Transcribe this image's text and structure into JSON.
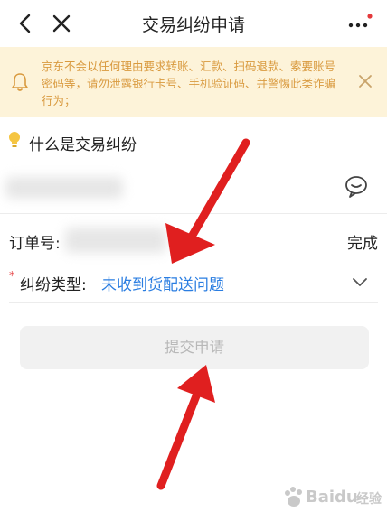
{
  "nav": {
    "title": "交易纠纷申请",
    "back_icon": "chevron-left-icon",
    "close_icon": "close-icon",
    "more_icon": "more-dots-icon"
  },
  "notice": {
    "text": "京东不会以任何理由要求转账、汇款、扫码退款、索要账号密码等，请勿泄露银行卡号、手机验证码、并警惕此类诈骗行为；"
  },
  "help": {
    "text": "什么是交易纠纷"
  },
  "form": {
    "order_label": "订单号:",
    "order_done": "完成",
    "type_label": "纠纷类型:",
    "type_value": "未收到货配送问题",
    "required_mark": "*"
  },
  "submit": {
    "label": "提交申请"
  },
  "watermark": {
    "brand": "Baidu",
    "suffix": "经验"
  },
  "colors": {
    "notice_bg": "#fdf3d9",
    "notice_text": "#d99a3f",
    "link_blue": "#2a7de1",
    "arrow_red": "#e01f1f",
    "required_red": "#e4393c"
  }
}
